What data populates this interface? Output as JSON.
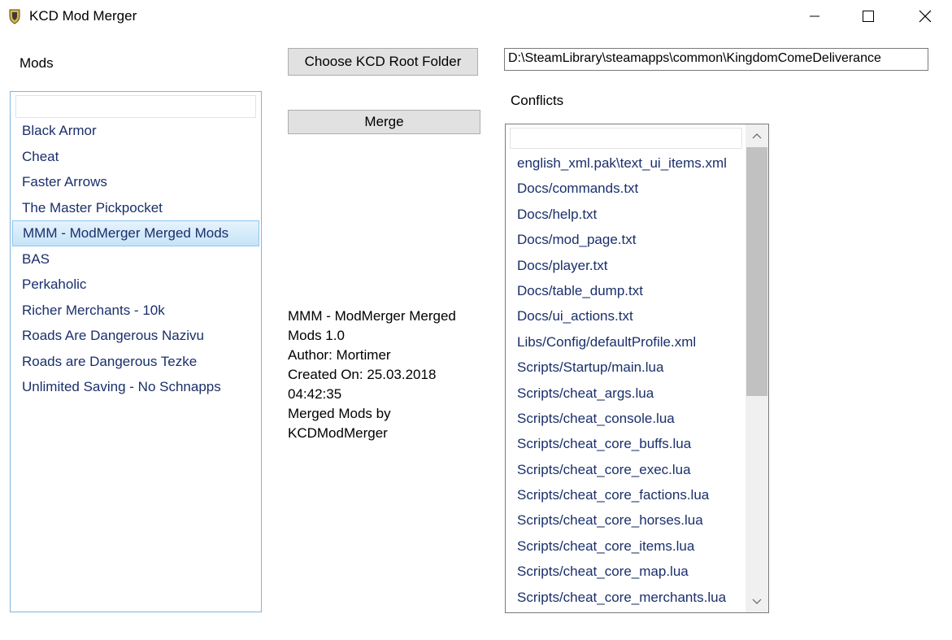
{
  "window": {
    "title": "KCD Mod Merger",
    "controls": {
      "minimize": "minimize-icon",
      "maximize": "maximize-icon",
      "close": "close-icon"
    }
  },
  "mods": {
    "label": "Mods",
    "filter_value": "",
    "items": [
      "Black Armor",
      "Cheat",
      "Faster Arrows",
      "The Master Pickpocket",
      "MMM - ModMerger Merged Mods",
      "BAS",
      "Perkaholic",
      "Richer Merchants - 10k",
      "Roads Are Dangerous Nazivu",
      "Roads are Dangerous Tezke",
      "Unlimited Saving - No Schnapps"
    ],
    "selected_index": 4
  },
  "buttons": {
    "choose_root": "Choose KCD Root Folder",
    "merge": "Merge"
  },
  "root_path": "D:\\SteamLibrary\\steamapps\\common\\KingdomComeDeliverance",
  "info": {
    "lines": [
      "MMM - ModMerger Merged",
      "Mods 1.0",
      "Author: Mortimer",
      "Created On: 25.03.2018",
      "04:42:35",
      "Merged Mods by",
      "KCDModMerger"
    ]
  },
  "conflicts": {
    "label": "Conflicts",
    "filter_value": "",
    "items": [
      "english_xml.pak\\text_ui_items.xml",
      "Docs/commands.txt",
      "Docs/help.txt",
      "Docs/mod_page.txt",
      "Docs/player.txt",
      "Docs/table_dump.txt",
      "Docs/ui_actions.txt",
      "Libs/Config/defaultProfile.xml",
      "Scripts/Startup/main.lua",
      "Scripts/cheat_args.lua",
      "Scripts/cheat_console.lua",
      "Scripts/cheat_core_buffs.lua",
      "Scripts/cheat_core_exec.lua",
      "Scripts/cheat_core_factions.lua",
      "Scripts/cheat_core_horses.lua",
      "Scripts/cheat_core_items.lua",
      "Scripts/cheat_core_map.lua",
      "Scripts/cheat_core_merchants.lua"
    ]
  },
  "colors": {
    "list_text": "#1a2f6b",
    "selection_border": "#8fc6ef",
    "list_border": "#82b4dc"
  }
}
